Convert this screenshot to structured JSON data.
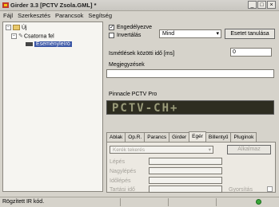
{
  "window": {
    "title": "Girder 3.3 [PCTV Zsola.GML] *",
    "min": "_",
    "max": "□",
    "close": "×"
  },
  "menu": [
    "Fájl",
    "Szerkesztés",
    "Parancsok",
    "Segítség"
  ],
  "tree": {
    "root": "Új",
    "group": "Csatorna fel",
    "event": "Eseményleíró"
  },
  "panel": {
    "enable_label": "Engedélyezve",
    "enable_checked": "✓",
    "invert_label": "Invertálás",
    "mode_value": "Mind",
    "learn_button": "Esetet tanulása",
    "comments_label": "Megjegyzések",
    "repeat_label": "Ismétlések közötti idő [ms]",
    "repeat_value": "0",
    "device_label": "Pinnacle PCTV Pro",
    "lcd_text": "PCTV-CH+"
  },
  "tabs": [
    "Ablak",
    "Op.R.",
    "Parancs",
    "Girder",
    "Egér",
    "Billentyű",
    "Pluginok"
  ],
  "active_tab": "Egér",
  "tabpage": {
    "select_placeholder": "Kerék tekerés",
    "apply_button": "Alkalmaz",
    "fields": [
      "Lépés",
      "Nagylépés",
      "Időlépés",
      "Tartási idő"
    ],
    "accel_label": "Gyorsítás"
  },
  "status": {
    "text": "Rögzített IR kód."
  }
}
